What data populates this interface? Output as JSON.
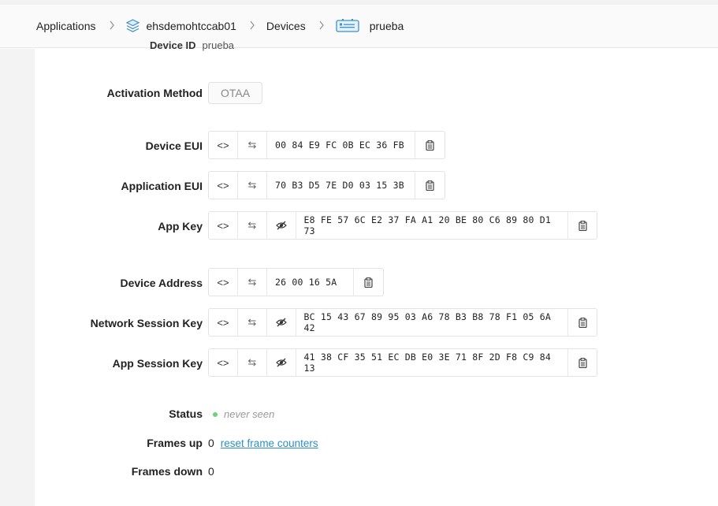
{
  "breadcrumb": {
    "items": [
      {
        "label": "Applications",
        "icon": null
      },
      {
        "label": "ehsdemohtccab01",
        "icon": "layers-icon"
      },
      {
        "label": "Devices",
        "icon": null
      },
      {
        "label": "prueba",
        "icon": "device-icon"
      }
    ],
    "separator": ">"
  },
  "clipped_row": {
    "label": "Device ID",
    "value": "prueba"
  },
  "activation": {
    "label": "Activation Method",
    "value": "OTAA"
  },
  "fields": {
    "device_eui": {
      "label": "Device EUI",
      "value": "00 84 E9 FC 0B EC 36 FB"
    },
    "application_eui": {
      "label": "Application EUI",
      "value": "70 B3 D5 7E D0 03 15 3B"
    },
    "app_key": {
      "label": "App Key",
      "value": "E8 FE 57 6C E2 37 FA A1 20 BE 80 C6 89 80 D1 73"
    },
    "device_address": {
      "label": "Device Address",
      "value": "26 00 16 5A"
    },
    "network_session_key": {
      "label": "Network Session Key",
      "value": "BC 15 43 67 89 95 03 A6 78 B3 B8 78 F1 05 6A 42"
    },
    "app_session_key": {
      "label": "App Session Key",
      "value": "41 38 CF 35 51 EC DB E0 3E 71 8F 2D F8 C9 84 13"
    }
  },
  "field_buttons": {
    "format": "<>",
    "swap": "⇆"
  },
  "status": {
    "label": "Status",
    "value": "never seen",
    "dot_color": "#6fd17a"
  },
  "frames_up": {
    "label": "Frames up",
    "value": "0",
    "link": "reset frame counters"
  },
  "frames_down": {
    "label": "Frames down",
    "value": "0"
  },
  "colors": {
    "link": "#2d8fc7",
    "status_dot": "#6fd17a"
  }
}
